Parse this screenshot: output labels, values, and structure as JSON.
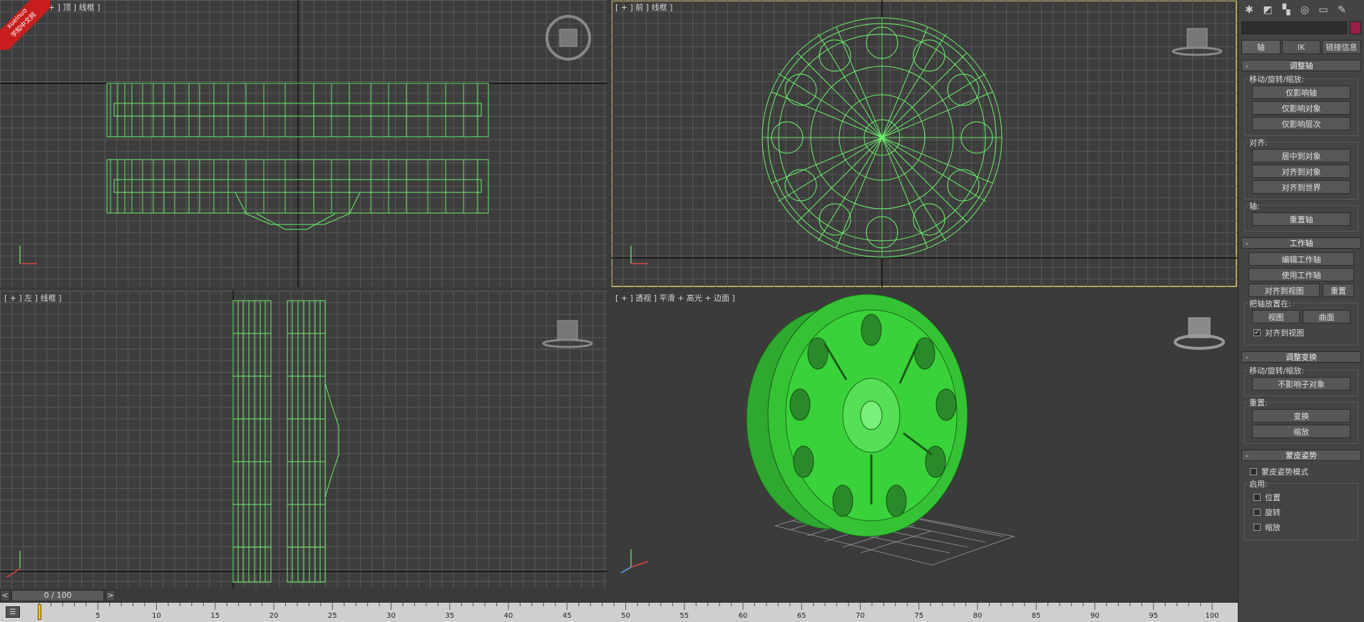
{
  "viewports": {
    "top": {
      "label": "[ + ] 顶 ] 线框 ]"
    },
    "front": {
      "label": "[ + ] 前 ] 线框 ]"
    },
    "left": {
      "label": "[ + ] 左 ] 线框 ]"
    },
    "perspective": {
      "label": "[ + ] 透视 ] 平滑 + 高光 + 边面 ]"
    }
  },
  "logo": {
    "line1": "xueinuo",
    "line2": "学知中文网"
  },
  "panel": {
    "tabs": [
      "轴",
      "IK",
      "链接信息"
    ],
    "adjust_pivot": {
      "title": "调整轴",
      "move_group": "移动/旋转/缩放:",
      "affect_pivot_only": "仅影响轴",
      "affect_object_only": "仅影响对象",
      "affect_hierarchy_only": "仅影响层次",
      "align_group": "对齐:",
      "center_to_object": "居中到对象",
      "align_to_object": "对齐到对象",
      "align_to_world": "对齐到世界",
      "pivot_group": "轴:",
      "reset_pivot": "重置轴"
    },
    "working_pivot": {
      "title": "工作轴",
      "edit_working_pivot": "编辑工作轴",
      "use_working_pivot": "使用工作轴",
      "align_to_view": "对齐到视图",
      "reset": "重置",
      "place_group": "把轴放置在:",
      "view": "视图",
      "surface": "曲面",
      "align_to_view_check": "对齐到视图"
    },
    "adjust_transform": {
      "title": "调整变换",
      "move_group": "移动/旋转/缩放:",
      "dont_affect_children": "不影响子对象",
      "reset_group": "重置:",
      "transform": "变换",
      "scale": "缩放"
    },
    "skin_pose": {
      "title": "蒙皮姿势",
      "skin_pose_mode": "蒙皮姿势模式",
      "enable_group": "启用:",
      "position": "位置",
      "rotation": "旋转",
      "scale": "缩放"
    }
  },
  "timeline": {
    "frame_display": "0 / 100",
    "prev": "<",
    "next": ">",
    "ticks": [
      "5",
      "10",
      "15",
      "20",
      "25",
      "30",
      "35",
      "40",
      "45",
      "50",
      "55",
      "60",
      "65",
      "70",
      "75",
      "80",
      "85",
      "90",
      "95",
      "100"
    ]
  }
}
